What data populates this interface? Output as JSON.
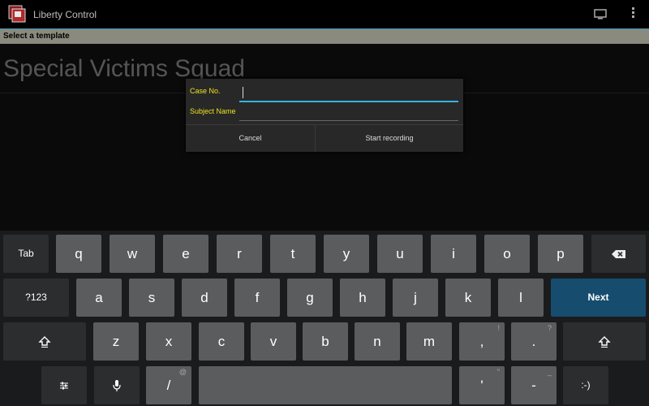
{
  "actionbar": {
    "title": "Liberty Control",
    "icons": [
      "app-logo-icon",
      "monitor-icon",
      "overflow-menu-icon"
    ]
  },
  "banner": {
    "text": "Select a template"
  },
  "template": {
    "title": "Special Victims Squad"
  },
  "dialog": {
    "case_no_label": "Case No.",
    "case_no_value": "",
    "subject_label": "Subject Name",
    "subject_value": "",
    "cancel_label": "Cancel",
    "start_label": "Start recording"
  },
  "keyboard": {
    "tab": "Tab",
    "row1": [
      "q",
      "w",
      "e",
      "r",
      "t",
      "y",
      "u",
      "i",
      "o",
      "p"
    ],
    "symbols": "?123",
    "row2": [
      "a",
      "s",
      "d",
      "f",
      "g",
      "h",
      "j",
      "k",
      "l"
    ],
    "next": "Next",
    "row3": [
      "z",
      "x",
      "c",
      "v",
      "b",
      "n",
      "m",
      ",",
      "."
    ],
    "row3_hints": [
      "",
      "",
      "",
      "",
      "",
      "",
      "",
      "!",
      "?"
    ],
    "slash": "/",
    "slash_hint": "@",
    "apostrophe": "'",
    "apostrophe_hint": "\"",
    "dash": "-",
    "dash_hint": "_",
    "smiley": ":-)",
    "accent_color": "#33b5e5",
    "label_color": "#f0e21e"
  }
}
